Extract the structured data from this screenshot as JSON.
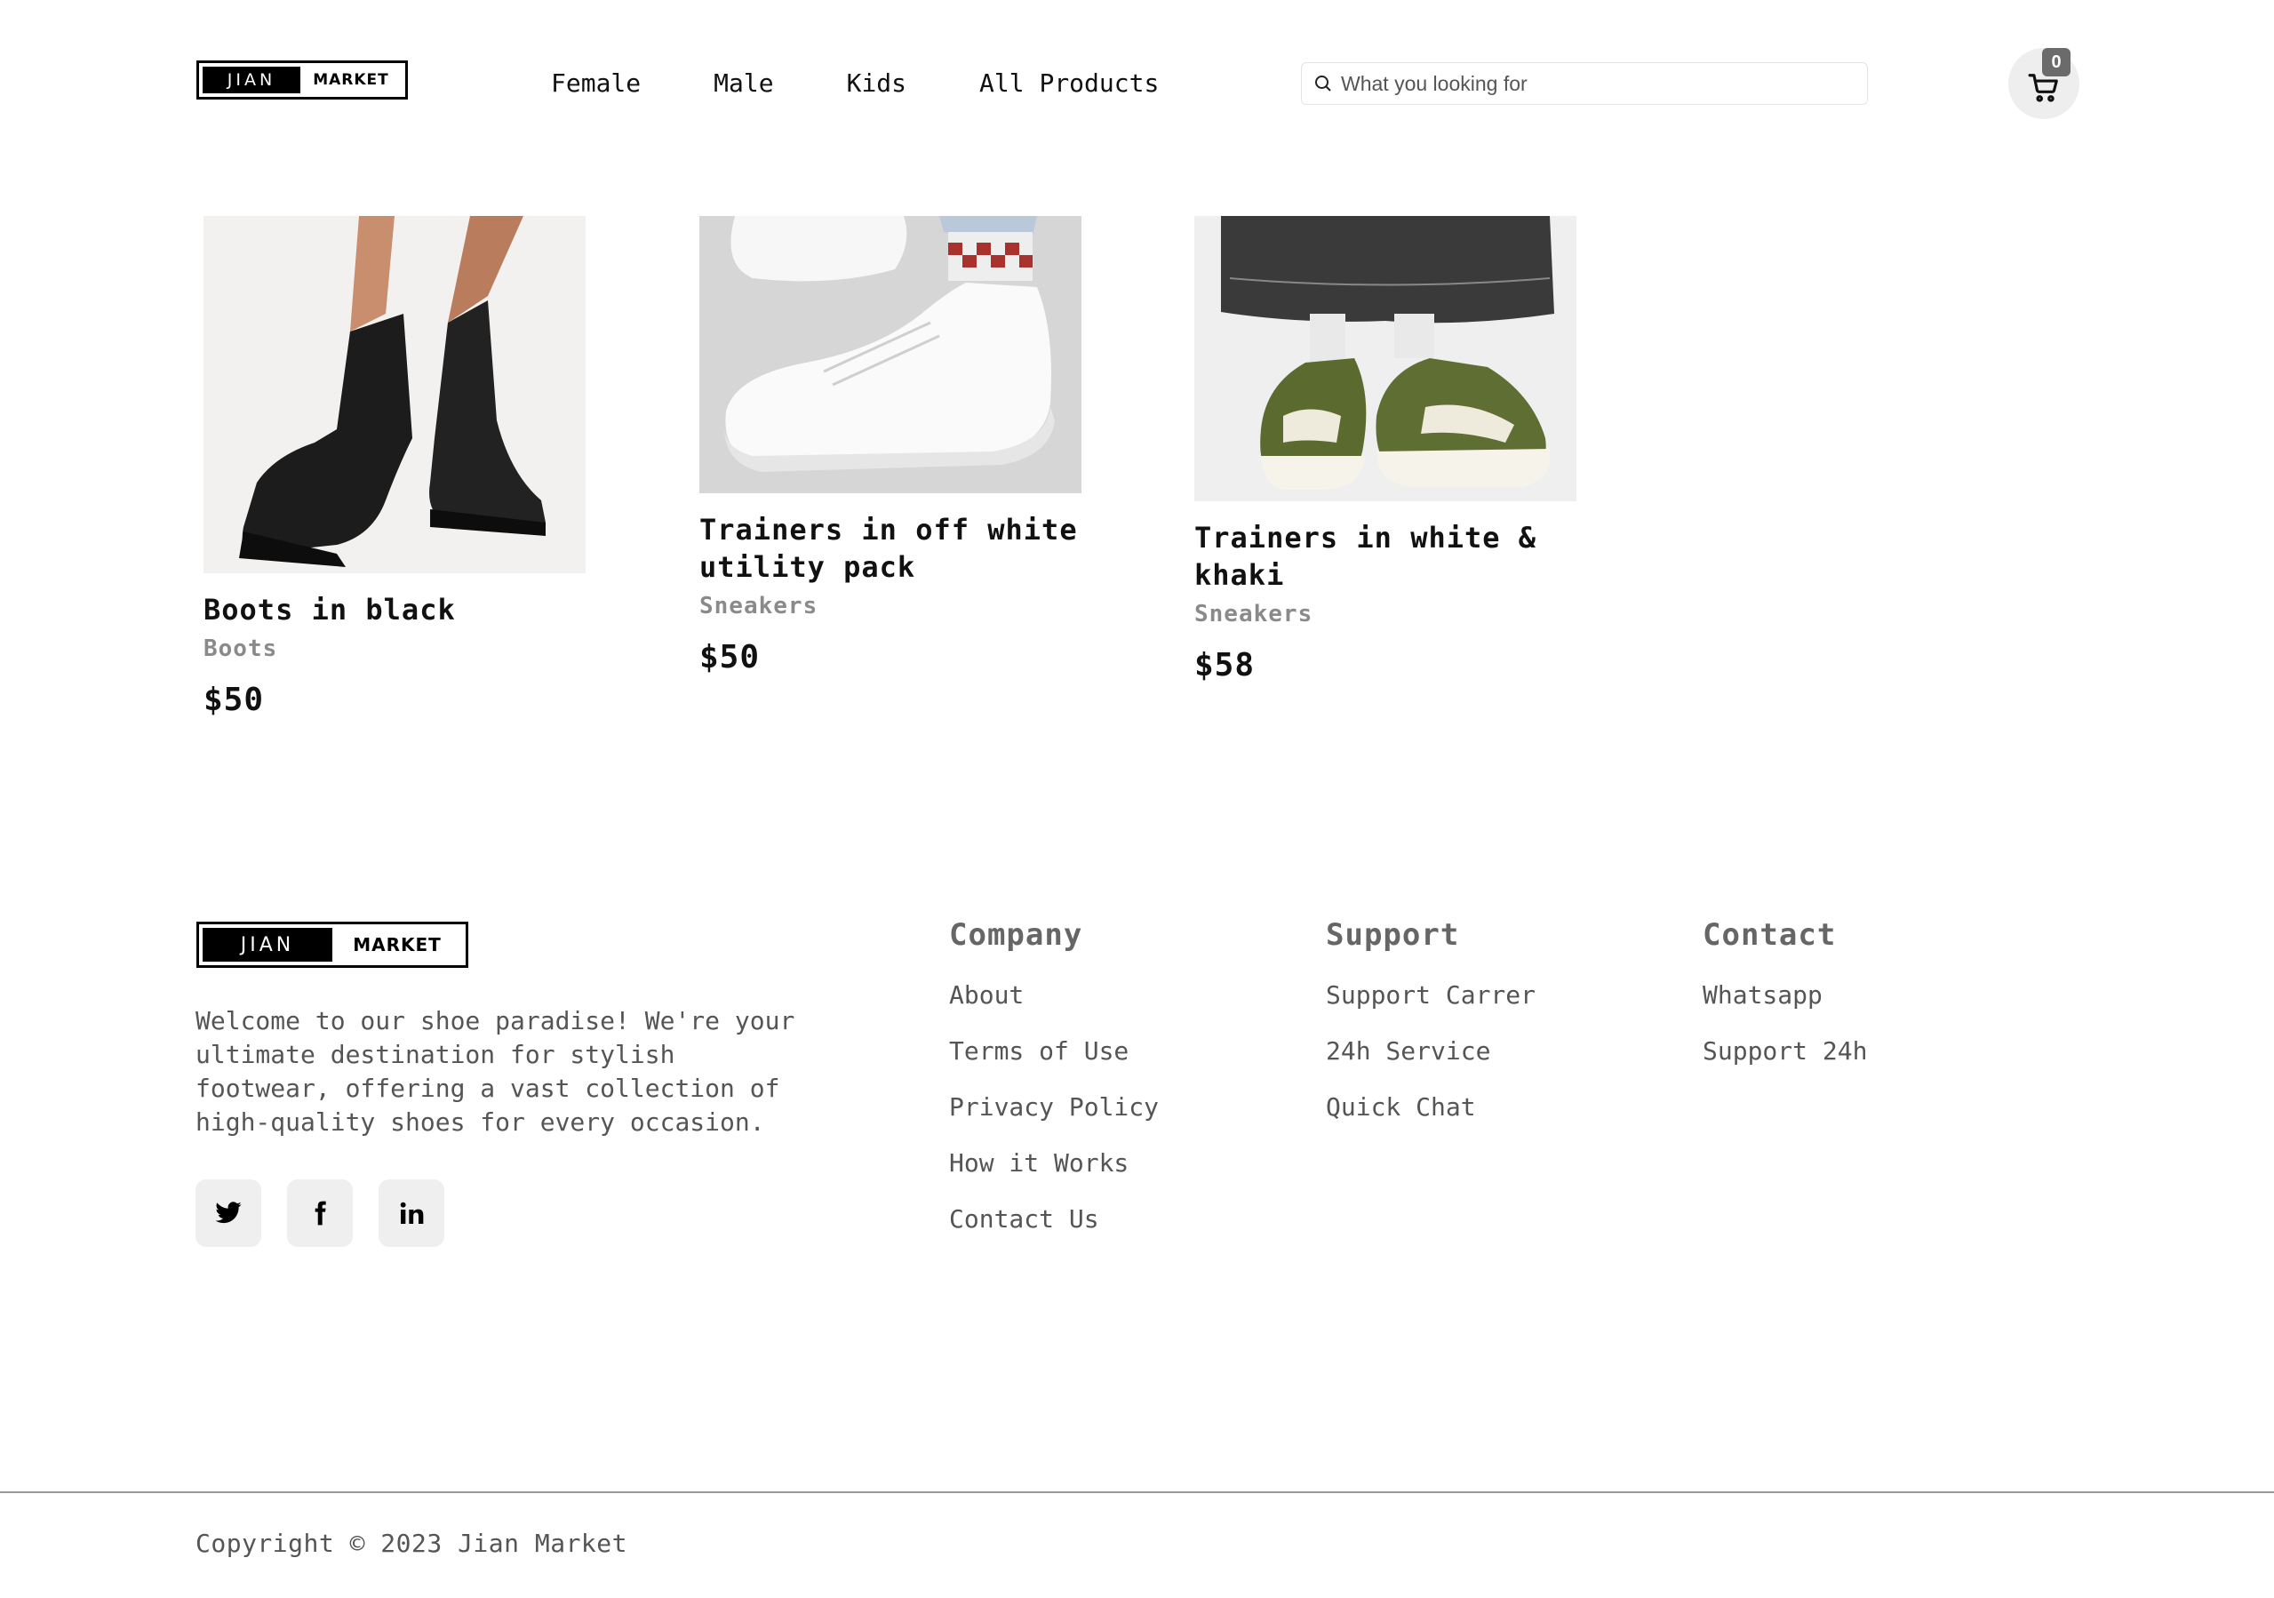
{
  "brand": {
    "logo_left": "JIAN",
    "logo_right": "MARKET"
  },
  "nav": {
    "items": [
      {
        "label": "Female"
      },
      {
        "label": "Male"
      },
      {
        "label": "Kids"
      },
      {
        "label": "All Products"
      }
    ]
  },
  "search": {
    "placeholder": "What you looking for",
    "value": ""
  },
  "cart": {
    "count": "0"
  },
  "products": [
    {
      "name": "Boots in black",
      "category": "Boots",
      "price": "$50",
      "image": "black-chelsea-boots"
    },
    {
      "name": "Trainers in off white utility pack",
      "category": "Sneakers",
      "price": "$50",
      "image": "white-trainers"
    },
    {
      "name": "Trainers in white & khaki",
      "category": "Sneakers",
      "price": "$58",
      "image": "khaki-trainers"
    }
  ],
  "footer": {
    "about": "Welcome to our shoe paradise! We're your ultimate destination for stylish footwear, offering a vast collection of high-quality shoes for every occasion.",
    "socials": [
      "twitter-icon",
      "facebook-icon",
      "linkedin-icon"
    ],
    "company": {
      "title": "Company",
      "links": [
        "About",
        "Terms of Use",
        "Privacy Policy",
        "How it Works",
        "Contact Us"
      ]
    },
    "support": {
      "title": "Support",
      "links": [
        "Support Carrer",
        "24h Service",
        "Quick Chat"
      ]
    },
    "contact": {
      "title": "Contact",
      "links": [
        "Whatsapp",
        "Support 24h"
      ]
    },
    "copyright": "Copyright © 2023 Jian Market"
  },
  "colors": {
    "accent": "#000000",
    "muted_text": "#555555",
    "category_text": "#8a8a8a",
    "badge": "#6b6b6b"
  }
}
